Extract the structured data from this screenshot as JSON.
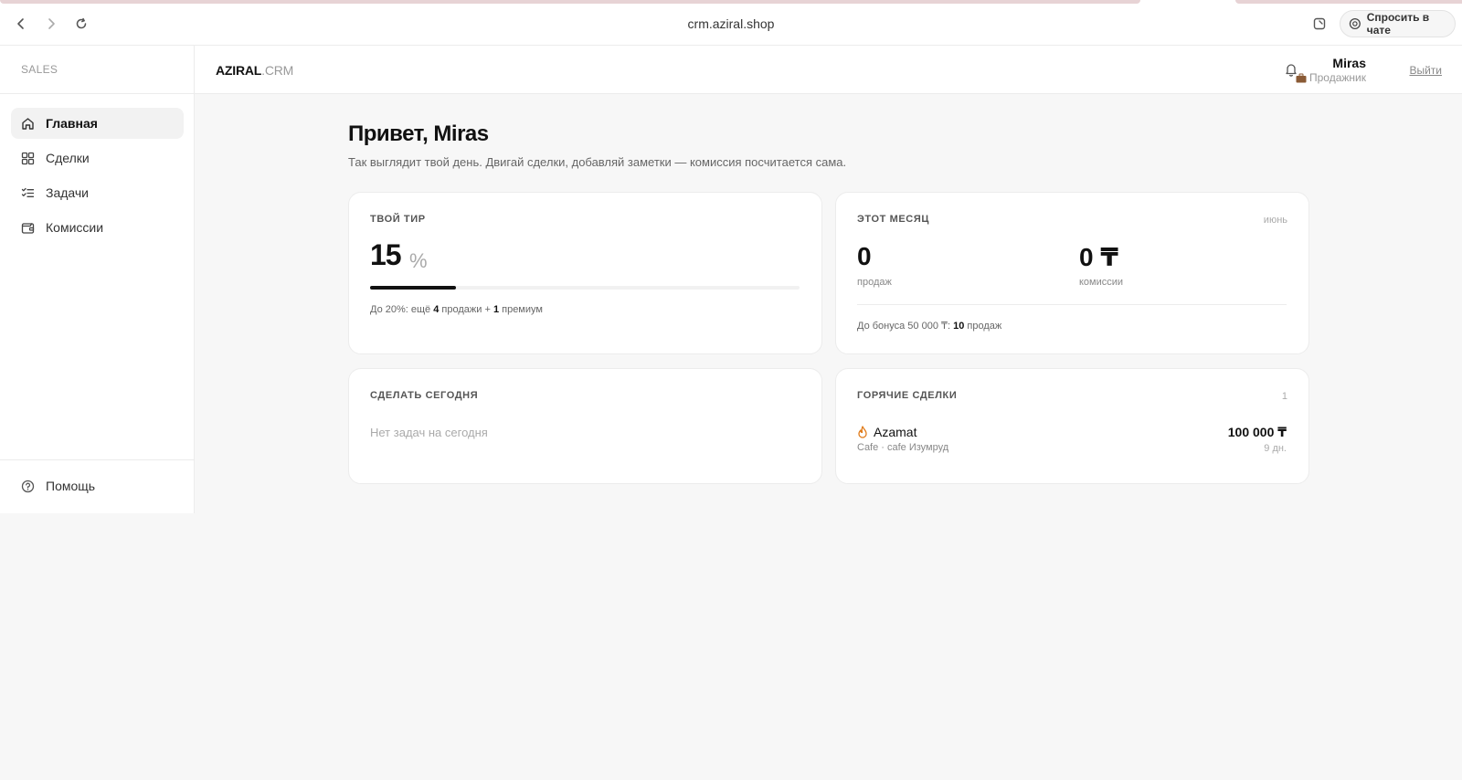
{
  "browser": {
    "url": "crm.aziral.shop",
    "chat_button": "Спросить в чате"
  },
  "sidebar": {
    "brand": "SALES",
    "items": [
      {
        "label": "Главная",
        "icon": "home-icon",
        "active": true
      },
      {
        "label": "Сделки",
        "icon": "grid-icon"
      },
      {
        "label": "Задачи",
        "icon": "checklist-icon"
      },
      {
        "label": "Комиссии",
        "icon": "wallet-icon"
      }
    ],
    "help": {
      "label": "Помощь",
      "icon": "help-circle-icon"
    }
  },
  "header": {
    "logo_main": "AZIRAL",
    "logo_suffix": ".CRM",
    "user_name": "Miras",
    "user_role": "Продажник",
    "logout": "Выйти"
  },
  "main": {
    "greeting": "Привет, Miras",
    "subtitle": "Так выглядит твой день. Двигай сделки, добавляй заметки — комиссия посчитается сама."
  },
  "tier_card": {
    "title": "ТВОЙ ТИР",
    "value": "15",
    "unit": "%",
    "progress_fraction": 0.2,
    "note_prefix": "До 20%: ещё ",
    "note_sales_count": "4",
    "note_mid": " продажи + ",
    "note_premium_count": "1",
    "note_suffix": " премиум"
  },
  "month_card": {
    "title": "ЭТОТ МЕСЯЦ",
    "month": "июнь",
    "sales_value": "0",
    "sales_label": "продаж",
    "commission_value": "0 ₸",
    "commission_label": "комиссии",
    "note_prefix": "До бонуса 50 000 ₸: ",
    "note_count": "10",
    "note_suffix": " продаж"
  },
  "today_card": {
    "title": "СДЕЛАТЬ СЕГОДНЯ",
    "empty": "Нет задач на сегодня"
  },
  "hot_card": {
    "title": "ГОРЯЧИЕ СДЕЛКИ",
    "count": "1",
    "deals": [
      {
        "name": "Azamat",
        "meta": "Cafe · cafe Изумруд",
        "amount": "100 000 ₸",
        "age": "9 дн."
      }
    ]
  }
}
